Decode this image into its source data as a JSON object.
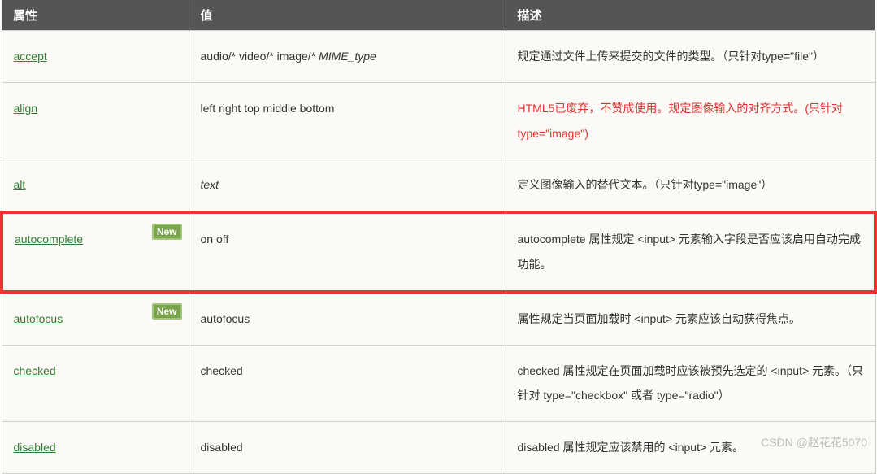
{
  "headers": {
    "attr": "属性",
    "value": "值",
    "desc": "描述"
  },
  "badge_text": "New",
  "rows": [
    {
      "attr": "accept",
      "value_plain": "audio/* video/* image/* ",
      "value_italic": "MIME_type",
      "desc": "规定通过文件上传来提交的文件的类型。（只针对type=\"file\"）"
    },
    {
      "attr": "align",
      "value_plain": "left right top middle bottom",
      "desc": "HTML5已废弃，不赞成使用。规定图像输入的对齐方式。(只针对type=\"image\")",
      "deprecated": true
    },
    {
      "attr": "alt",
      "value_italic": "text",
      "desc": "定义图像输入的替代文本。（只针对type=\"image\"）"
    },
    {
      "attr": "autocomplete",
      "new": true,
      "highlight": true,
      "value_plain": "on off",
      "desc": "autocomplete 属性规定 <input> 元素输入字段是否应该启用自动完成功能。"
    },
    {
      "attr": "autofocus",
      "new": true,
      "value_plain": "autofocus",
      "desc": "属性规定当页面加载时 <input> 元素应该自动获得焦点。"
    },
    {
      "attr": "checked",
      "value_plain": "checked",
      "desc": "checked 属性规定在页面加载时应该被预先选定的 <input> 元素。（只针对 type=\"checkbox\" 或者 type=\"radio\"）"
    },
    {
      "attr": "disabled",
      "value_plain": "disabled",
      "desc": "disabled 属性规定应该禁用的 <input> 元素。"
    }
  ],
  "watermark": "CSDN @赵花花5070"
}
